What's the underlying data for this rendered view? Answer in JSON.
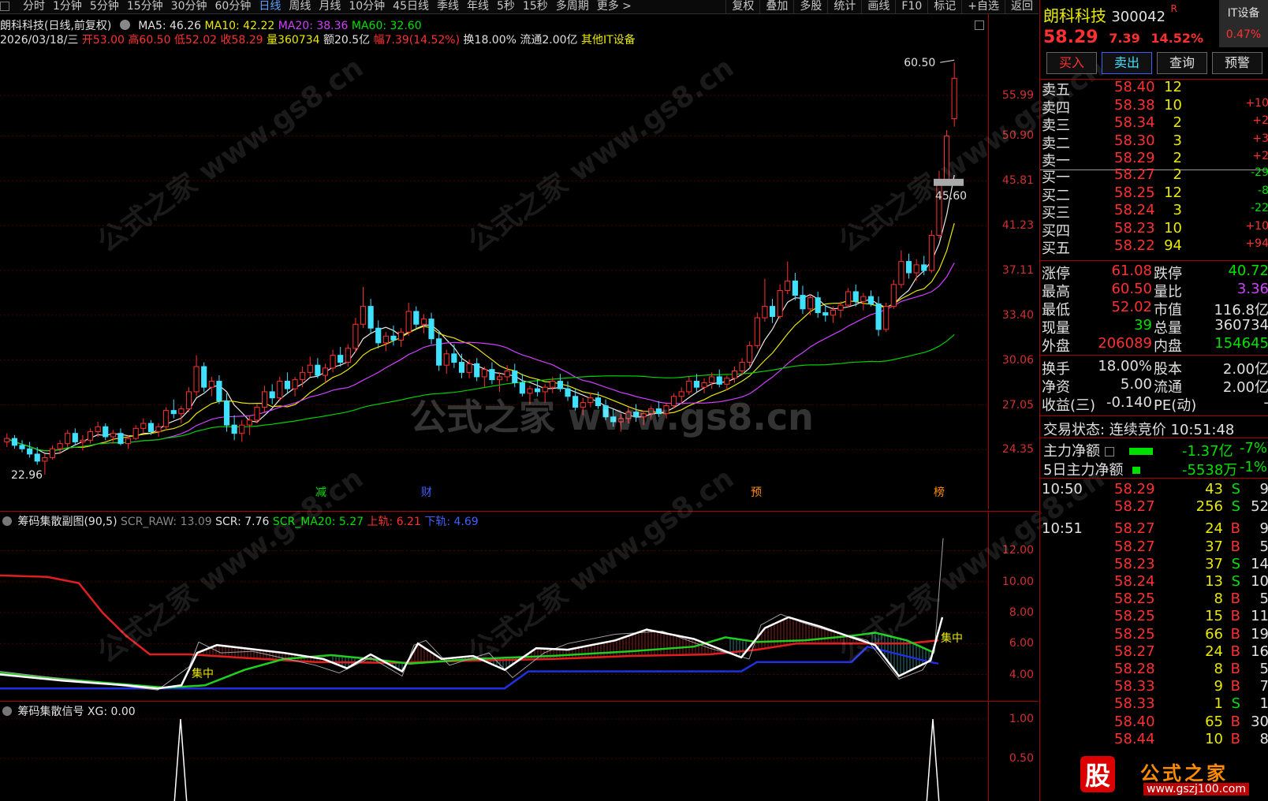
{
  "toolbar": {
    "periods": [
      "分时",
      "1分钟",
      "5分钟",
      "15分钟",
      "30分钟",
      "60分钟",
      "日线",
      "周线",
      "月线",
      "10分钟",
      "45日线",
      "季线",
      "年线",
      "5秒",
      "15秒",
      "多周期",
      "更多 >"
    ],
    "active_period": "日线",
    "tools": [
      "复权",
      "叠加",
      "多股",
      "统计",
      "画线",
      "F10",
      "标记",
      "+自选",
      "返回"
    ]
  },
  "main_chart": {
    "header_line1": {
      "title": "朗科科技(日线,前复权)",
      "ma5": "MA5: 46.26",
      "ma10": "MA10: 42.22",
      "ma20": "MA20: 38.36",
      "ma60": "MA60: 32.60"
    },
    "header_line2": {
      "date": "2026/03/18/三",
      "open": "开53.00",
      "high": "高60.50",
      "low": "低52.02",
      "close": "收58.29",
      "volume": "量360734",
      "amount": "额20.5亿",
      "change": "幅7.39(14.52%)",
      "turnover": "换18.00%",
      "float": "流通2.00亿",
      "sector": "其他IT设备"
    },
    "y_ticks": [
      "55.99",
      "50.90",
      "45.81",
      "41.23",
      "37.11",
      "33.40",
      "30.06",
      "27.05",
      "24.35"
    ],
    "annotations": {
      "high_label": "60.50",
      "low_label": "22.96",
      "price_flag": "45.60"
    },
    "event_markers": [
      "减",
      "财",
      "预",
      "榜"
    ],
    "watermark_center": "公式之家 www.gs8.cn",
    "watermark": "公式之家 www.gs8.cn"
  },
  "chart_data": {
    "type": "candlestick",
    "ylim": [
      22.5,
      62
    ],
    "ohlc": [
      [
        24.8,
        25.3,
        24.5,
        25.0
      ],
      [
        25.0,
        25.2,
        24.4,
        24.6
      ],
      [
        24.6,
        24.9,
        24.2,
        24.4
      ],
      [
        24.4,
        24.8,
        23.9,
        24.1
      ],
      [
        24.1,
        24.5,
        23.5,
        23.7
      ],
      [
        23.7,
        24.1,
        22.96,
        23.9
      ],
      [
        23.9,
        24.6,
        23.8,
        24.4
      ],
      [
        24.4,
        24.9,
        24.1,
        24.7
      ],
      [
        24.7,
        25.5,
        24.5,
        25.3
      ],
      [
        25.3,
        25.6,
        24.6,
        24.8
      ],
      [
        24.8,
        25.2,
        24.3,
        24.9
      ],
      [
        24.9,
        25.6,
        24.7,
        25.4
      ],
      [
        25.4,
        26.0,
        25.1,
        25.7
      ],
      [
        25.7,
        25.9,
        24.9,
        25.1
      ],
      [
        25.1,
        25.5,
        24.7,
        25.3
      ],
      [
        25.3,
        25.6,
        24.6,
        24.7
      ],
      [
        24.7,
        25.2,
        24.4,
        25.0
      ],
      [
        25.0,
        25.8,
        24.9,
        25.6
      ],
      [
        25.6,
        26.2,
        25.3,
        25.9
      ],
      [
        25.9,
        26.1,
        25.2,
        25.4
      ],
      [
        25.4,
        25.9,
        25.1,
        25.7
      ],
      [
        25.7,
        26.9,
        25.5,
        26.7
      ],
      [
        26.7,
        27.4,
        26.2,
        26.5
      ],
      [
        26.5,
        27.0,
        25.9,
        26.8
      ],
      [
        26.8,
        28.2,
        26.6,
        27.9
      ],
      [
        27.9,
        30.4,
        27.6,
        29.6
      ],
      [
        29.6,
        29.9,
        27.9,
        28.2
      ],
      [
        28.2,
        28.9,
        27.6,
        28.6
      ],
      [
        28.6,
        29.0,
        27.1,
        27.3
      ],
      [
        27.3,
        27.8,
        25.4,
        25.8
      ],
      [
        25.8,
        26.4,
        24.9,
        25.3
      ],
      [
        25.3,
        26.1,
        24.8,
        25.8
      ],
      [
        25.8,
        26.4,
        25.2,
        26.1
      ],
      [
        26.1,
        27.1,
        25.9,
        26.9
      ],
      [
        26.9,
        28.3,
        26.6,
        27.9
      ],
      [
        27.9,
        28.4,
        27.1,
        27.5
      ],
      [
        27.5,
        28.9,
        27.3,
        28.6
      ],
      [
        28.6,
        29.2,
        27.8,
        28.1
      ],
      [
        28.1,
        28.9,
        27.6,
        28.7
      ],
      [
        28.7,
        29.6,
        28.2,
        29.2
      ],
      [
        29.2,
        30.3,
        28.9,
        29.7
      ],
      [
        29.7,
        30.2,
        28.8,
        29.0
      ],
      [
        29.0,
        29.8,
        28.5,
        29.5
      ],
      [
        29.5,
        30.8,
        29.2,
        30.4
      ],
      [
        30.4,
        31.0,
        29.6,
        29.9
      ],
      [
        29.9,
        31.2,
        29.6,
        30.9
      ],
      [
        30.9,
        33.2,
        30.6,
        32.7
      ],
      [
        32.7,
        35.7,
        32.4,
        34.1
      ],
      [
        34.1,
        34.7,
        32.0,
        32.4
      ],
      [
        32.4,
        33.0,
        30.9,
        31.3
      ],
      [
        31.3,
        32.1,
        30.7,
        31.8
      ],
      [
        31.8,
        32.6,
        31.1,
        31.5
      ],
      [
        31.5,
        32.4,
        31.0,
        32.1
      ],
      [
        32.1,
        34.4,
        31.8,
        33.7
      ],
      [
        33.7,
        34.1,
        32.3,
        32.7
      ],
      [
        32.7,
        33.5,
        32.0,
        33.1
      ],
      [
        33.1,
        33.6,
        31.2,
        31.6
      ],
      [
        31.6,
        32.2,
        29.3,
        29.7
      ],
      [
        29.7,
        30.8,
        29.1,
        30.5
      ],
      [
        30.5,
        31.2,
        29.5,
        29.9
      ],
      [
        29.9,
        30.5,
        28.8,
        29.2
      ],
      [
        29.2,
        30.1,
        28.8,
        29.8
      ],
      [
        29.8,
        30.2,
        28.6,
        28.9
      ],
      [
        28.9,
        29.6,
        28.2,
        29.4
      ],
      [
        29.4,
        29.9,
        28.4,
        28.7
      ],
      [
        28.7,
        29.2,
        27.9,
        28.9
      ],
      [
        28.9,
        29.7,
        28.6,
        29.3
      ],
      [
        29.3,
        29.8,
        28.2,
        28.5
      ],
      [
        28.5,
        29.1,
        27.6,
        27.8
      ],
      [
        27.8,
        28.3,
        27.1,
        28.1
      ],
      [
        28.1,
        28.7,
        27.6,
        27.9
      ],
      [
        27.9,
        28.4,
        27.2,
        28.2
      ],
      [
        28.2,
        28.9,
        27.8,
        28.6
      ],
      [
        28.6,
        29.1,
        27.9,
        28.1
      ],
      [
        28.1,
        28.6,
        27.3,
        27.6
      ],
      [
        27.6,
        28.1,
        26.7,
        26.9
      ],
      [
        26.9,
        27.5,
        26.4,
        27.2
      ],
      [
        27.2,
        27.8,
        26.9,
        27.5
      ],
      [
        27.5,
        27.9,
        26.8,
        27.0
      ],
      [
        27.0,
        27.4,
        26.1,
        26.3
      ],
      [
        26.3,
        26.8,
        25.7,
        26.0
      ],
      [
        26.0,
        26.5,
        25.4,
        26.2
      ],
      [
        26.2,
        26.9,
        25.9,
        26.6
      ],
      [
        26.6,
        27.1,
        26.0,
        26.3
      ],
      [
        26.3,
        26.7,
        25.8,
        26.5
      ],
      [
        26.5,
        27.0,
        26.1,
        26.8
      ],
      [
        26.8,
        27.3,
        26.3,
        26.5
      ],
      [
        26.5,
        27.2,
        26.2,
        27.0
      ],
      [
        27.0,
        27.8,
        26.8,
        27.6
      ],
      [
        27.6,
        28.2,
        27.1,
        27.9
      ],
      [
        27.9,
        28.9,
        27.7,
        28.6
      ],
      [
        28.6,
        29.1,
        27.9,
        28.2
      ],
      [
        28.2,
        28.8,
        27.8,
        28.5
      ],
      [
        28.5,
        29.2,
        28.1,
        28.9
      ],
      [
        28.9,
        29.4,
        28.2,
        28.4
      ],
      [
        28.4,
        29.0,
        28.0,
        28.8
      ],
      [
        28.8,
        29.6,
        28.5,
        29.3
      ],
      [
        29.3,
        30.2,
        29.0,
        29.9
      ],
      [
        29.9,
        31.4,
        29.6,
        31.1
      ],
      [
        31.1,
        33.6,
        30.9,
        33.2
      ],
      [
        33.2,
        36.4,
        32.9,
        34.1
      ],
      [
        34.1,
        34.7,
        32.8,
        33.3
      ],
      [
        33.3,
        35.9,
        33.1,
        35.4
      ],
      [
        35.4,
        37.9,
        35.1,
        36.2
      ],
      [
        36.2,
        36.9,
        34.6,
        35.0
      ],
      [
        35.0,
        35.8,
        33.5,
        33.9
      ],
      [
        33.9,
        35.1,
        33.4,
        34.8
      ],
      [
        34.8,
        35.3,
        33.2,
        33.6
      ],
      [
        33.6,
        34.2,
        32.9,
        33.4
      ],
      [
        33.4,
        34.1,
        32.8,
        33.8
      ],
      [
        33.8,
        34.5,
        33.2,
        34.2
      ],
      [
        34.2,
        35.6,
        34.0,
        35.3
      ],
      [
        35.3,
        35.9,
        34.1,
        34.5
      ],
      [
        34.5,
        35.2,
        33.8,
        34.9
      ],
      [
        34.9,
        35.4,
        34.1,
        34.3
      ],
      [
        34.3,
        34.9,
        31.8,
        32.3
      ],
      [
        32.3,
        34.4,
        32.1,
        34.1
      ],
      [
        34.1,
        36.3,
        33.9,
        35.9
      ],
      [
        35.9,
        38.9,
        35.6,
        37.9
      ],
      [
        37.9,
        38.6,
        36.4,
        36.9
      ],
      [
        36.9,
        38.1,
        36.2,
        37.6
      ],
      [
        37.6,
        38.4,
        36.7,
        37.1
      ],
      [
        37.1,
        40.8,
        36.9,
        40.3
      ],
      [
        40.3,
        46.9,
        40.0,
        45.6
      ],
      [
        45.6,
        51.6,
        45.4,
        50.9
      ],
      [
        53.0,
        60.5,
        52.02,
        58.29
      ]
    ],
    "indicators": [
      "MA5",
      "MA10",
      "MA20",
      "MA60"
    ]
  },
  "sub_chart": {
    "title": "筹码集散副图(90,5)",
    "scr_raw": "SCR_RAW: 13.09",
    "scr": "SCR: 7.76",
    "scr_ma20": "SCR_MA20: 5.27",
    "upper": "上轨: 6.21",
    "lower": "下轨: 4.69",
    "y_ticks": [
      "12.00",
      "10.00",
      "8.00",
      "6.00",
      "4.00"
    ],
    "label_concentrate": "集中"
  },
  "signal_chart": {
    "title": "筹码集散信号",
    "xg": "XG: 0.00",
    "y_ticks": [
      "1.00",
      "0.50"
    ]
  },
  "quote": {
    "name": "朗科科技",
    "code": "300042",
    "flag": "R",
    "price": "58.29",
    "change": "7.39",
    "pct": "14.52%",
    "sector_label": "IT设备",
    "sector_pct": "0.47%",
    "buttons": [
      "买入",
      "卖出",
      "查询",
      "预警"
    ],
    "asks": [
      {
        "label": "卖五",
        "price": "58.40",
        "vol": "12",
        "chg": ""
      },
      {
        "label": "卖四",
        "price": "58.38",
        "vol": "10",
        "chg": "+10"
      },
      {
        "label": "卖三",
        "price": "58.34",
        "vol": "2",
        "chg": "+2"
      },
      {
        "label": "卖二",
        "price": "58.30",
        "vol": "3",
        "chg": "+3"
      },
      {
        "label": "卖一",
        "price": "58.29",
        "vol": "2",
        "chg": "+2"
      }
    ],
    "bids": [
      {
        "label": "买一",
        "price": "58.27",
        "vol": "2",
        "chg": "-29"
      },
      {
        "label": "买二",
        "price": "58.25",
        "vol": "12",
        "chg": "-8"
      },
      {
        "label": "买三",
        "price": "58.24",
        "vol": "3",
        "chg": "-22"
      },
      {
        "label": "买四",
        "price": "58.23",
        "vol": "10",
        "chg": "+10"
      },
      {
        "label": "买五",
        "price": "58.22",
        "vol": "94",
        "chg": "+94"
      }
    ],
    "stats": [
      {
        "k1": "涨停",
        "v1": "61.08",
        "k2": "跌停",
        "v2": "40.72"
      },
      {
        "k1": "最高",
        "v1": "60.50",
        "k2": "量比",
        "v2": "3.36"
      },
      {
        "k1": "最低",
        "v1": "52.02",
        "k2": "市值",
        "v2": "116.8亿"
      },
      {
        "k1": "现量",
        "v1": "39",
        "k2": "总量",
        "v2": "360734"
      },
      {
        "k1": "外盘",
        "v1": "206089",
        "k2": "内盘",
        "v2": "154645"
      }
    ],
    "stats2": [
      {
        "k1": "换手",
        "v1": "18.00%",
        "k2": "股本",
        "v2": "2.00亿"
      },
      {
        "k1": "净资",
        "v1": "5.00",
        "k2": "流通",
        "v2": "2.00亿"
      },
      {
        "k1": "收益(三)",
        "v1": "-0.140",
        "k2": "PE(动)",
        "v2": "-"
      }
    ],
    "trade_status": "交易状态: 连续竞价 10:51:48",
    "main_net": {
      "label": "主力净额",
      "value": "-1.37亿",
      "pct": "-7%"
    },
    "main_net5": {
      "label": "5日主力净额",
      "value": "-5538万",
      "pct": "-1%"
    },
    "ticks": [
      {
        "time": "10:50",
        "price": "58.29",
        "vol": "43",
        "side": "S",
        "n": "9"
      },
      {
        "time": "",
        "price": "58.27",
        "vol": "256",
        "side": "S",
        "n": "52"
      },
      {
        "time": "10:51",
        "price": "58.27",
        "vol": "24",
        "side": "B",
        "n": "9"
      },
      {
        "time": "",
        "price": "58.27",
        "vol": "37",
        "side": "B",
        "n": "5"
      },
      {
        "time": "",
        "price": "58.23",
        "vol": "37",
        "side": "S",
        "n": "14"
      },
      {
        "time": "",
        "price": "58.24",
        "vol": "13",
        "side": "S",
        "n": "10"
      },
      {
        "time": "",
        "price": "58.25",
        "vol": "8",
        "side": "B",
        "n": "5"
      },
      {
        "time": "",
        "price": "58.25",
        "vol": "15",
        "side": "B",
        "n": "11"
      },
      {
        "time": "",
        "price": "58.25",
        "vol": "66",
        "side": "B",
        "n": "19"
      },
      {
        "time": "",
        "price": "58.27",
        "vol": "24",
        "side": "B",
        "n": "16"
      },
      {
        "time": "",
        "price": "58.28",
        "vol": "8",
        "side": "B",
        "n": "5"
      },
      {
        "time": "",
        "price": "58.33",
        "vol": "9",
        "side": "B",
        "n": "7"
      },
      {
        "time": "",
        "price": "58.33",
        "vol": "1",
        "side": "S",
        "n": "1"
      },
      {
        "time": "",
        "price": "58.40",
        "vol": "65",
        "side": "B",
        "n": "30"
      },
      {
        "time": "",
        "price": "58.44",
        "vol": "10",
        "side": "B",
        "n": "8"
      }
    ],
    "logo_text": "公式之家",
    "logo_url": "www.gszj100.com",
    "logo_badge": "股"
  }
}
